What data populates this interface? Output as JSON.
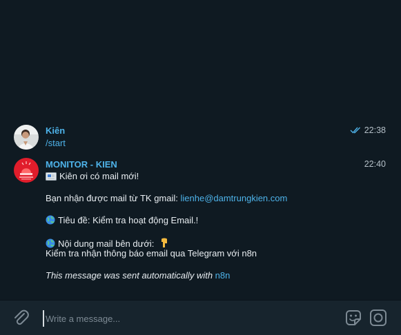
{
  "messages": [
    {
      "sender": "Kiên",
      "time": "22:38",
      "text": "/start",
      "avatar_icon": "user-avatar"
    },
    {
      "sender": "MONITOR - KIEN",
      "time": "22:40",
      "avatar_icon": "siren-avatar",
      "line1": "Kiên ơi có mail mới!",
      "line2_prefix": "Bạn nhận được mail từ TK gmail: ",
      "line2_email": "lienhe@damtrungkien.com",
      "line3": "Tiêu đề: Kiểm tra hoạt động Email.!",
      "line4": "Nội dung mail bên dưới:",
      "line5": "Kiểm tra nhận thông báo email qua Telegram với n8n",
      "line6_prefix": "This message was sent automatically with ",
      "line6_link": "n8n"
    }
  ],
  "composer": {
    "placeholder": "Write a message..."
  },
  "colors": {
    "background": "#0f1a22",
    "composer": "#17242d",
    "accent": "#4eb3ea"
  }
}
